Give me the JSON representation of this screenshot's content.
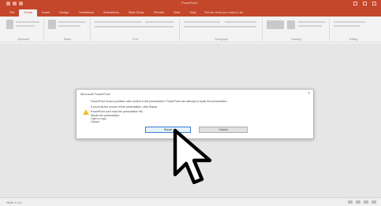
{
  "window": {
    "app_title": "PowerPoint",
    "controls": [
      "minimize",
      "maximize",
      "close"
    ]
  },
  "tabs": [
    {
      "label": "File"
    },
    {
      "label": "Home",
      "active": true
    },
    {
      "label": "Insert"
    },
    {
      "label": "Design"
    },
    {
      "label": "Transitions"
    },
    {
      "label": "Animations"
    },
    {
      "label": "Slide Show"
    },
    {
      "label": "Review"
    },
    {
      "label": "View"
    },
    {
      "label": "Help"
    }
  ],
  "tell_me": "Tell me what you want to do",
  "ribbon_groups": [
    "Clipboard",
    "Slides",
    "Font",
    "Paragraph",
    "Drawing",
    "Editing"
  ],
  "dialog": {
    "title": "Microsoft PowerPoint",
    "message_lines": [
      "PowerPoint found a problem with content in the presentation. PowerPoint can attempt to repair the presentation.",
      "If you trust the source of this presentation, click Repair."
    ],
    "detail_lines": [
      "PowerPoint can't read the presentation file.",
      "Repair the presentation",
      "Open a copy",
      "Cancel"
    ],
    "buttons": {
      "repair": "Repair",
      "cancel": "Cancel"
    }
  },
  "status": {
    "left": "Slide 1 of 1"
  },
  "colors": {
    "accent": "#c4472b",
    "warning": "#f2c12e",
    "workspace": "#e6e6e6"
  },
  "icons": {
    "dialog_icon": "warning-icon",
    "pointer": "mouse-cursor-icon"
  }
}
